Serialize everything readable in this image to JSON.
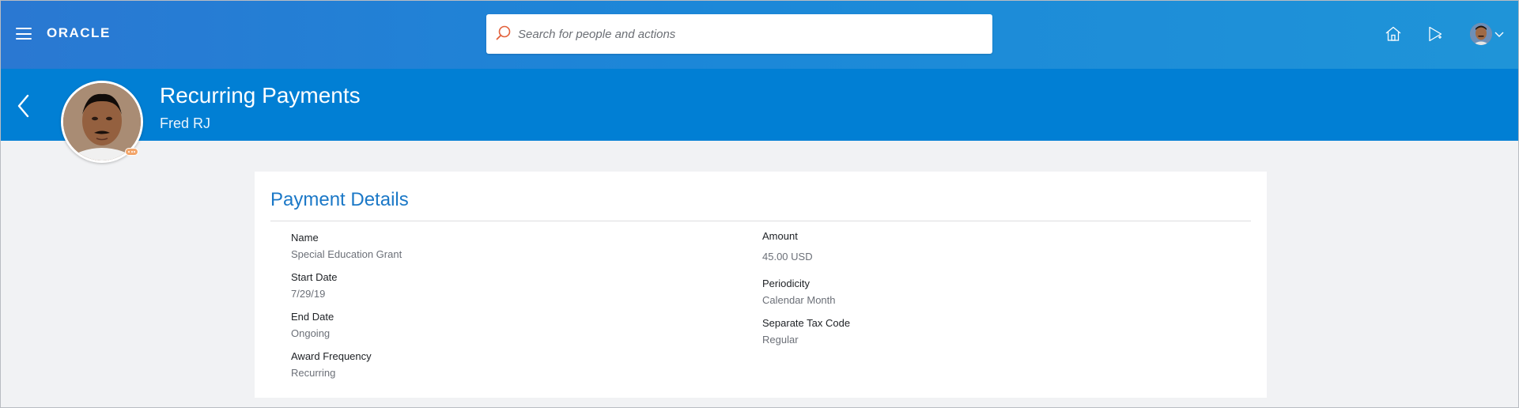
{
  "header": {
    "logo": "ORACLE",
    "search_placeholder": "Search for people and actions"
  },
  "subheader": {
    "title": "Recurring Payments",
    "person": "Fred RJ"
  },
  "card": {
    "title": "Payment Details",
    "left_fields": [
      {
        "label": "Name",
        "value": "Special Education Grant"
      },
      {
        "label": "Start Date",
        "value": "7/29/19"
      },
      {
        "label": "End Date",
        "value": "Ongoing"
      },
      {
        "label": "Award Frequency",
        "value": "Recurring"
      }
    ],
    "right_fields": [
      {
        "label": "Amount",
        "value": "45.00 USD"
      },
      {
        "label": "Periodicity",
        "value": "Calendar Month"
      },
      {
        "label": "Separate Tax Code",
        "value": "Regular"
      }
    ]
  },
  "colors": {
    "header_start": "#2a78d2",
    "header_end": "#1f94d8",
    "subheader": "#017fd4",
    "card_title": "#1b78c7",
    "search_icon": "#e2603a"
  },
  "icons": [
    "menu-icon",
    "search-icon",
    "home-icon",
    "play-icon",
    "chevron-down-icon",
    "back-arrow-icon",
    "presence-icon"
  ]
}
